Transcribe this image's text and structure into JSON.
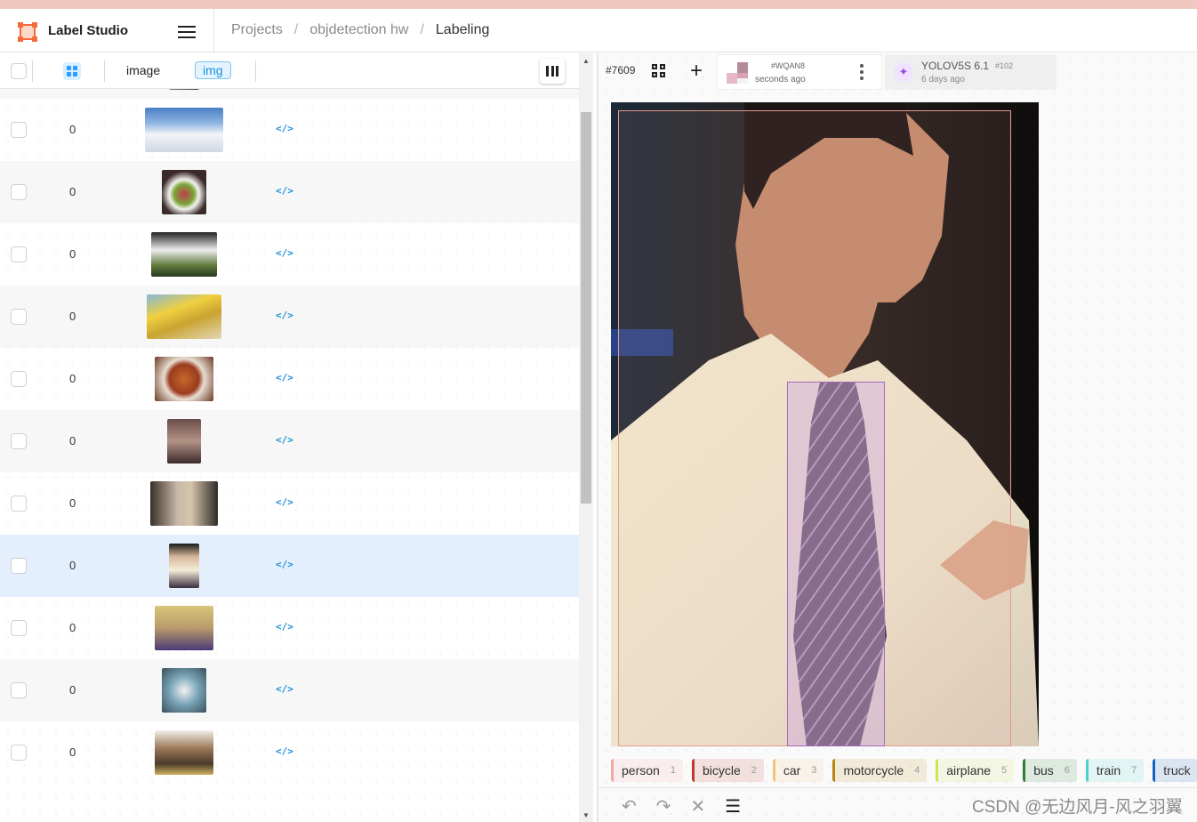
{
  "app": {
    "title": "Label Studio"
  },
  "breadcrumbs": [
    {
      "label": "Projects"
    },
    {
      "label": "objdetection hw"
    },
    {
      "label": "Labeling"
    }
  ],
  "breadcrumb_separator": "/",
  "table": {
    "columns": [
      {
        "label": "image"
      },
      {
        "label": "img"
      }
    ],
    "rows": [
      {
        "value": "0",
        "code_icon": "</>"
      },
      {
        "value": "0",
        "code_icon": "</>"
      },
      {
        "value": "0",
        "code_icon": "</>"
      },
      {
        "value": "0",
        "code_icon": "</>"
      },
      {
        "value": "0",
        "code_icon": "</>"
      },
      {
        "value": "0",
        "code_icon": "</>"
      },
      {
        "value": "0",
        "code_icon": "</>"
      },
      {
        "value": "0",
        "code_icon": "</>"
      },
      {
        "value": "0",
        "code_icon": "</>",
        "selected": true
      },
      {
        "value": "0",
        "code_icon": "</>"
      },
      {
        "value": "0",
        "code_icon": "</>"
      },
      {
        "value": "0",
        "code_icon": "</>"
      }
    ]
  },
  "task": {
    "id": "#7609",
    "add_icon": "+",
    "annotation": {
      "id": "#WQAN8",
      "time": "seconds ago"
    },
    "prediction": {
      "name": "YOLOV5S 6.1",
      "id": "#102",
      "time": "6 days ago"
    }
  },
  "labels": [
    {
      "name": "person",
      "key": "1",
      "color": "#f4a6a0"
    },
    {
      "name": "bicycle",
      "key": "2",
      "color": "#c0392b"
    },
    {
      "name": "car",
      "key": "3",
      "color": "#f5c27a"
    },
    {
      "name": "motorcycle",
      "key": "4",
      "color": "#b8860b"
    },
    {
      "name": "airplane",
      "key": "5",
      "color": "#d4e157"
    },
    {
      "name": "bus",
      "key": "6",
      "color": "#2e7d32"
    },
    {
      "name": "train",
      "key": "7",
      "color": "#4dd0c8"
    },
    {
      "name": "truck",
      "key": "",
      "color": "#1565c0"
    }
  ],
  "bottom_tools": {
    "undo": "↶",
    "redo": "↷",
    "reset": "✕",
    "settings": "☰"
  },
  "watermark": "CSDN @无边风月-风之羽翼"
}
